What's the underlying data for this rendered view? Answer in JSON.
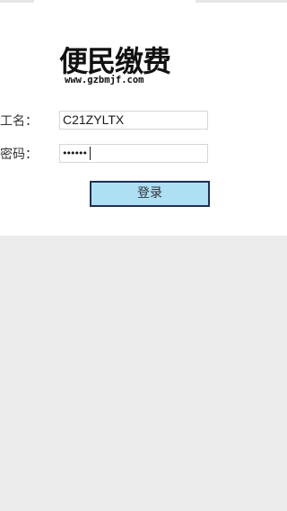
{
  "logo": {
    "title": "便民缴费",
    "url": "www.gzbmjf.com"
  },
  "form": {
    "username_label": "工名：",
    "username_value": "C21ZYLTX",
    "password_label": "密码：",
    "password_value": "••••••"
  },
  "login_button_label": "登录",
  "colors": {
    "button_fill": "#aee0f4",
    "button_border": "#1f2f55",
    "page_background": "#ebebeb"
  }
}
